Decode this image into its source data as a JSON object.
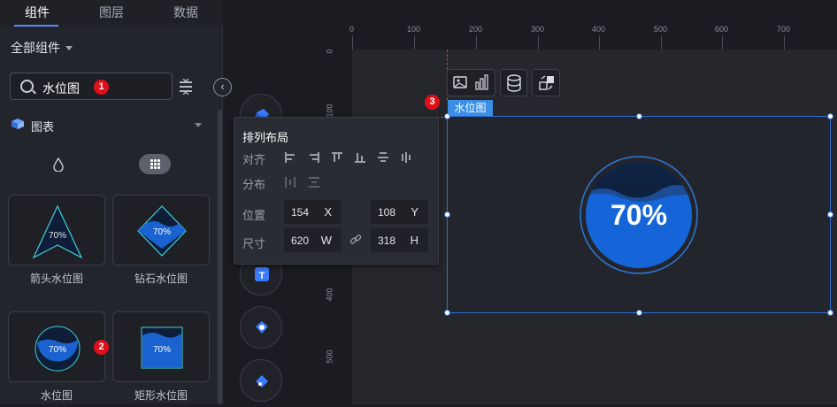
{
  "tabs": [
    {
      "label": "组件",
      "active": true
    },
    {
      "label": "图层",
      "active": false
    },
    {
      "label": "数据",
      "active": false
    }
  ],
  "left_panel": {
    "all_components_label": "全部组件",
    "search_value": "水位图",
    "category_label": "图表",
    "components": [
      {
        "label": "箭头水位图",
        "preview_value": "70%"
      },
      {
        "label": "钻石水位图",
        "preview_value": "70%"
      },
      {
        "label": "水位图",
        "preview_value": "70%"
      },
      {
        "label": "矩形水位图",
        "preview_value": "70%"
      }
    ]
  },
  "annotations": {
    "badge1": "1",
    "badge2": "2",
    "badge3": "3"
  },
  "ruler": {
    "h_labels": [
      "0",
      "100",
      "200",
      "300",
      "400",
      "500",
      "600",
      "700"
    ],
    "v_labels": [
      "0",
      "100",
      "400",
      "500"
    ]
  },
  "widget": {
    "tag": "水位图",
    "value": "70%"
  },
  "layout_popup": {
    "title": "排列布局",
    "align_label": "对齐",
    "distribute_label": "分布",
    "position_label": "位置",
    "size_label": "尺寸",
    "pos_x": "154",
    "pos_x_axis": "X",
    "pos_y": "108",
    "pos_y_axis": "Y",
    "width": "620",
    "width_axis": "W",
    "height": "318",
    "height_axis": "H"
  },
  "colors": {
    "accent": "#3a8ee6",
    "badge": "#e0101a",
    "water": "#1565d8"
  }
}
